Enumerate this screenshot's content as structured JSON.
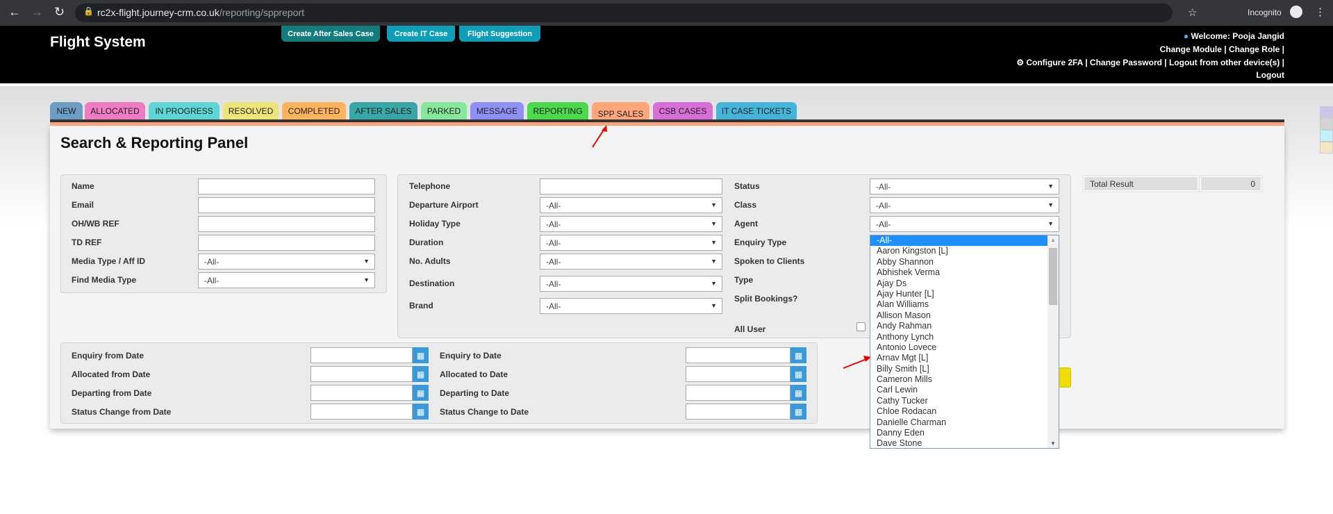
{
  "browser": {
    "url_host": "rc2x-flight.journey-crm.co.uk",
    "url_path": "/reporting/sppreport",
    "profile": "Incognito"
  },
  "header": {
    "brand": "Flight System",
    "buttons": [
      {
        "label": "Create After Sales Case",
        "color": "#137c7c"
      },
      {
        "label": "Create IT Case",
        "color": "#0e9eb8"
      },
      {
        "label": "Flight Suggestion",
        "color": "#0e9eb8"
      }
    ],
    "welcome": "Welcome: Pooja Jangid",
    "line2": "Change Module | Change Role |",
    "line3": "Configure 2FA | Change Password | Logout from other device(s) |",
    "logout": "Logout"
  },
  "tabs": [
    {
      "label": "NEW",
      "color": "#6e9dc3"
    },
    {
      "label": "ALLOCATED",
      "color": "#f07bc5"
    },
    {
      "label": "IN PROGRESS",
      "color": "#5fd5d5"
    },
    {
      "label": "RESOLVED",
      "color": "#ede57a"
    },
    {
      "label": "COMPLETED",
      "color": "#ffb35c"
    },
    {
      "label": "AFTER SALES",
      "color": "#3aa7a7"
    },
    {
      "label": "PARKED",
      "color": "#86e89a"
    },
    {
      "label": "MESSAGE",
      "color": "#8f8ff5"
    },
    {
      "label": "REPORTING",
      "color": "#4cd94c"
    },
    {
      "label": "SPP SALES",
      "color": "#ffa67b"
    },
    {
      "label": "CSB CASES",
      "color": "#d86fd8"
    },
    {
      "label": "IT CASE TICKETS",
      "color": "#45b4d8"
    }
  ],
  "panel": {
    "title": "Search & Reporting Panel",
    "box1": [
      {
        "label": "Name"
      },
      {
        "label": "Email"
      },
      {
        "label": "OH/WB REF"
      },
      {
        "label": "TD REF"
      },
      {
        "label": "Media Type / Aff ID",
        "value": "-All-"
      },
      {
        "label": "Find Media Type",
        "value": "-All-"
      }
    ],
    "box2a": [
      {
        "label": "Telephone"
      },
      {
        "label": "Departure Airport",
        "value": "-All-"
      },
      {
        "label": "Holiday Type",
        "value": "-All-"
      },
      {
        "label": "Duration",
        "value": "-All-"
      },
      {
        "label": "No. Adults",
        "value": "-All-"
      },
      {
        "label": "Destination",
        "value": "-All-"
      },
      {
        "label": "Brand",
        "value": "-All-"
      }
    ],
    "box2b": [
      {
        "label": "Status",
        "value": "-All-"
      },
      {
        "label": "Class",
        "value": "-All-"
      },
      {
        "label": "Agent",
        "value": "-All-"
      },
      {
        "label": "Enquiry Type"
      },
      {
        "label": "Spoken to Clients"
      },
      {
        "label": "Type"
      },
      {
        "label": "Split Bookings?"
      },
      {
        "label": "All User"
      }
    ],
    "dates_from": [
      "Enquiry from Date",
      "Allocated from Date",
      "Departing from Date",
      "Status Change from Date"
    ],
    "dates_to": [
      "Enquiry to Date",
      "Allocated to Date",
      "Departing to Date",
      "Status Change to Date"
    ],
    "total_label": "Total Result",
    "total_value": "0"
  },
  "agent_options": [
    "-All-",
    "Aaron Kingston [L]",
    "Abby Shannon",
    "Abhishek Verma",
    "Ajay Ds",
    "Ajay Hunter [L]",
    "Alan Williams",
    "Allison Mason",
    "Andy Rahman",
    "Anthony Lynch",
    "Antonio Lovece",
    "Arnav Mgt [L]",
    "Billy Smith [L]",
    "Cameron Mills",
    "Carl Lewin",
    "Cathy Tucker",
    "Chloe Rodacan",
    "Danielle Charman",
    "Danny Eden",
    "Dave Stone"
  ]
}
